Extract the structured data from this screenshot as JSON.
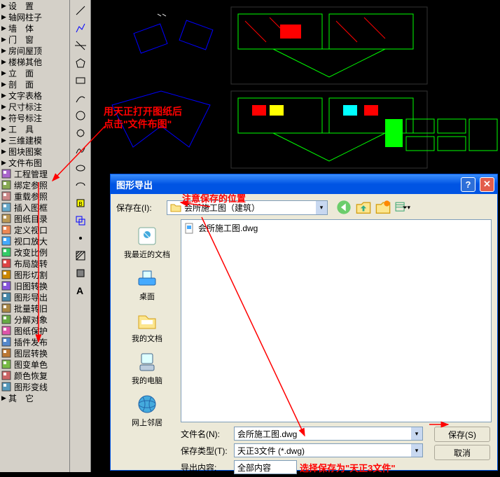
{
  "tree": [
    {
      "label": "设　置",
      "arrow": true
    },
    {
      "label": "轴网柱子",
      "arrow": true
    },
    {
      "label": "墙　体",
      "arrow": true
    },
    {
      "label": "门　窗",
      "arrow": true
    },
    {
      "label": "房间屋顶",
      "arrow": true
    },
    {
      "label": "楼梯其他",
      "arrow": true
    },
    {
      "label": "立　面",
      "arrow": true
    },
    {
      "label": "剖　面",
      "arrow": true
    },
    {
      "label": "文字表格",
      "arrow": true
    },
    {
      "label": "尺寸标注",
      "arrow": true
    },
    {
      "label": "符号标注",
      "arrow": true
    },
    {
      "label": "工　具",
      "arrow": true
    },
    {
      "label": "三维建模",
      "arrow": true
    },
    {
      "label": "图块图案",
      "arrow": true
    },
    {
      "label": "文件布图",
      "arrow": true
    },
    {
      "label": "工程管理",
      "icon": true
    },
    {
      "label": "绑定参照",
      "icon": true
    },
    {
      "label": "重载参照",
      "icon": true
    },
    {
      "label": "插入图框",
      "icon": true
    },
    {
      "label": "图纸目录",
      "icon": true
    },
    {
      "label": "定义视口",
      "icon": true
    },
    {
      "label": "视口放大",
      "icon": true
    },
    {
      "label": "改变比例",
      "icon": true
    },
    {
      "label": "布局旋转",
      "icon": true
    },
    {
      "label": "图形切割",
      "icon": true
    },
    {
      "label": "旧图转换",
      "icon": true
    },
    {
      "label": "图形导出",
      "icon": true
    },
    {
      "label": "批量转旧",
      "icon": true
    },
    {
      "label": "分解对象",
      "icon": true
    },
    {
      "label": "图纸保护",
      "icon": true
    },
    {
      "label": "插件发布",
      "icon": true
    },
    {
      "label": "图层转换",
      "icon": true
    },
    {
      "label": "图变单色",
      "icon": true
    },
    {
      "label": "颜色恢复",
      "icon": true
    },
    {
      "label": "图形变线",
      "icon": true
    },
    {
      "label": "其　它",
      "arrow": true
    }
  ],
  "annotations": {
    "a1_line1": "用天正打开图纸后",
    "a1_line2": "点击\"文件布图\"",
    "a2": "注意保存的位置",
    "a3": "选择保存为\"天正3文件\""
  },
  "dialog": {
    "title": "图形导出",
    "save_in_label": "保存在(I):",
    "save_in_value": "会所施工图（建筑）",
    "file_item": "会所施工图.dwg",
    "places": [
      {
        "label": "我最近的文档"
      },
      {
        "label": "桌面"
      },
      {
        "label": "我的文档"
      },
      {
        "label": "我的电脑"
      },
      {
        "label": "网上邻居"
      }
    ],
    "filename_label": "文件名(N):",
    "filename_value": "会所施工图.dwg",
    "savetype_label": "保存类型(T):",
    "savetype_value": "天正3文件 (*.dwg)",
    "export_label": "导出内容:",
    "export_value": "全部内容",
    "save_btn": "保存(S)",
    "cancel_btn": "取消"
  }
}
